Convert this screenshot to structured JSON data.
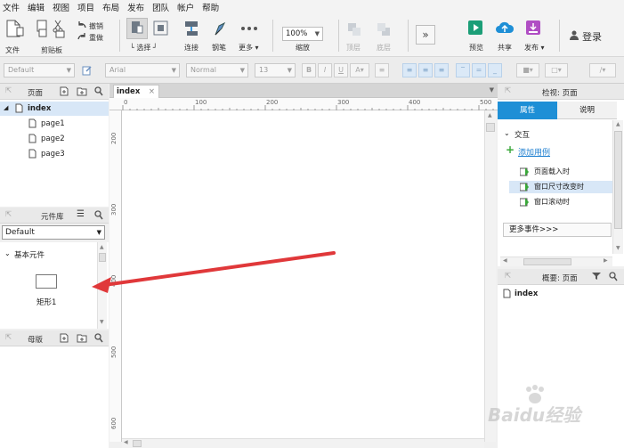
{
  "menu": [
    "文件",
    "编辑",
    "视图",
    "项目",
    "布局",
    "发布",
    "团队",
    "帐户",
    "帮助"
  ],
  "toolbar": {
    "file": "文件",
    "clipboard": "剪贴板",
    "undo": "撤销",
    "redo": "重做",
    "select": "选择",
    "connect": "连接",
    "pen": "钢笔",
    "more": "更多 ▾",
    "zoom_value": "100%",
    "zoom_label": "缩放",
    "top_layer": "顶层",
    "bottom_layer": "底层",
    "preview": "预览",
    "share": "共享",
    "publish": "发布 ▾",
    "login": "登录"
  },
  "format": {
    "style": "Default",
    "font": "Arial",
    "weight": "Normal",
    "size": "13"
  },
  "pages_panel": {
    "title": "页面",
    "root": "index",
    "children": [
      "page1",
      "page2",
      "page3"
    ]
  },
  "library_panel": {
    "title": "元件库",
    "selected": "Default",
    "group": "基本元件",
    "widget": "矩形1"
  },
  "masters_panel": {
    "title": "母版"
  },
  "canvas": {
    "tab": "index",
    "ruler_h": [
      "0",
      "100",
      "200",
      "300",
      "400",
      "500"
    ],
    "ruler_v": [
      "200",
      "300",
      "400",
      "500",
      "600"
    ]
  },
  "inspector": {
    "title": "检视: 页面",
    "tab_props": "属性",
    "tab_notes": "说明",
    "section": "交互",
    "add_case": "添加用例",
    "events": [
      "页面载入时",
      "窗口尺寸改变时",
      "窗口滚动时"
    ],
    "more_events": "更多事件>>>"
  },
  "outline_panel": {
    "title": "概要: 页面",
    "root": "index"
  },
  "watermark": "Baidu经验",
  "colors": {
    "accent": "#1e8fd6",
    "arrow": "#e0383a",
    "selected_row": "#d8e7f7"
  }
}
